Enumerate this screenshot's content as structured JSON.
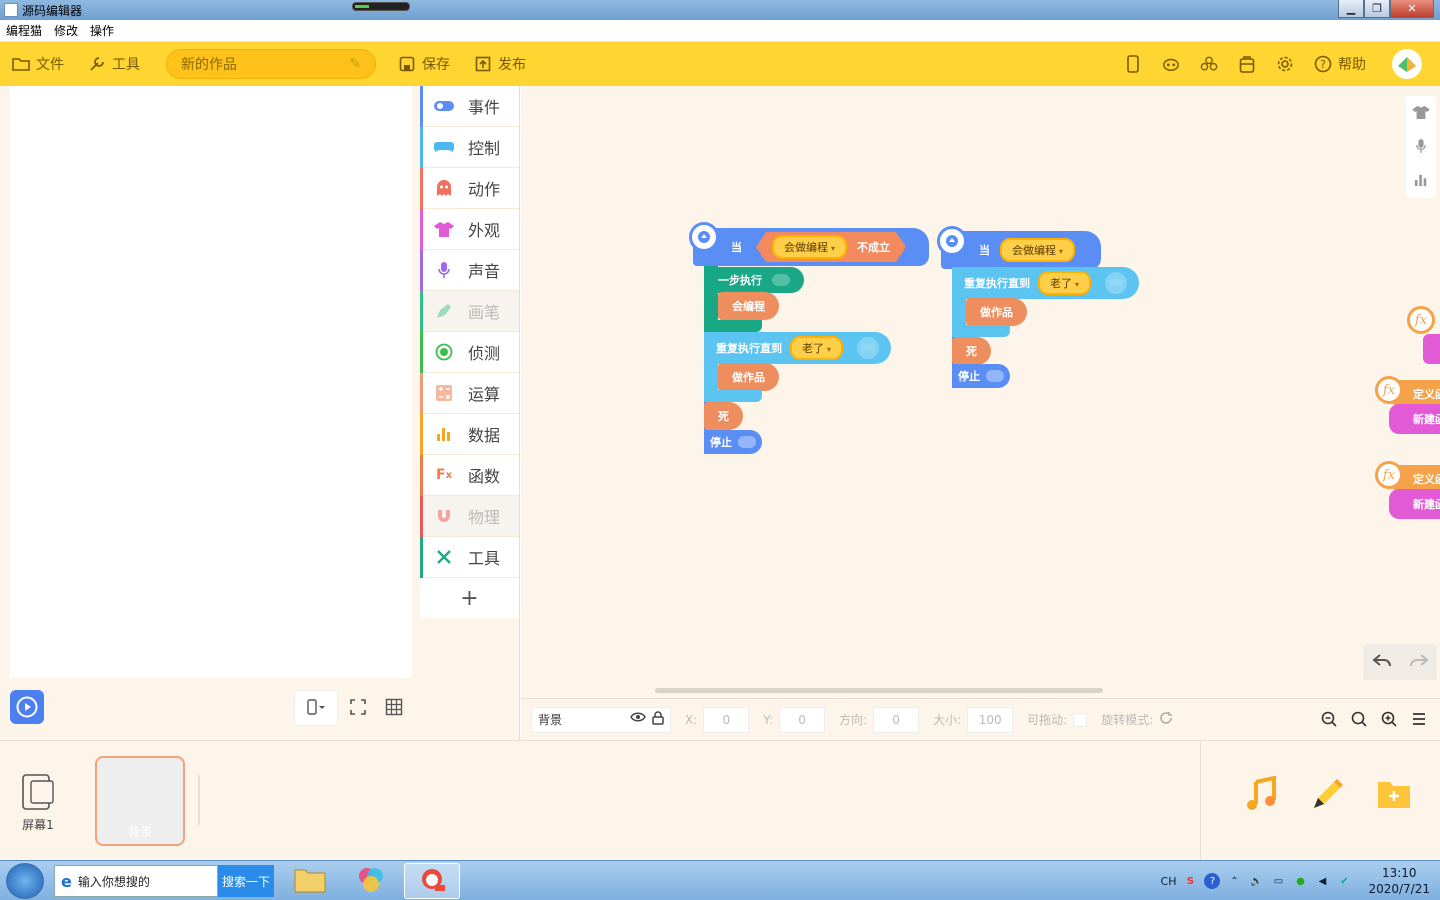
{
  "window": {
    "title": "源码编辑器"
  },
  "menu": {
    "items": [
      "编程猫",
      "修改",
      "操作"
    ]
  },
  "toolbar": {
    "file_label": "文件",
    "tools_label": "工具",
    "project_name": "新的作品",
    "save_label": "保存",
    "publish_label": "发布",
    "help_label": "帮助"
  },
  "categories": [
    {
      "label": "事件",
      "color": "#5b8ef5",
      "icon": "toggle-icon"
    },
    {
      "label": "控制",
      "color": "#4cb8f0",
      "icon": "gamepad-icon"
    },
    {
      "label": "动作",
      "color": "#f27060",
      "icon": "ghost-icon"
    },
    {
      "label": "外观",
      "color": "#e25ad6",
      "icon": "tshirt-icon"
    },
    {
      "label": "声音",
      "color": "#9f6ae8",
      "icon": "microphone-icon"
    },
    {
      "label": "画笔",
      "color": "#2fc08a",
      "icon": "pen-icon"
    },
    {
      "label": "侦测",
      "color": "#3cbf4a",
      "icon": "target-icon"
    },
    {
      "label": "运算",
      "color": "#f09a78",
      "icon": "calculator-icon"
    },
    {
      "label": "数据",
      "color": "#f5a623",
      "icon": "bar-chart-icon"
    },
    {
      "label": "函数",
      "color": "#f27a4a",
      "icon": "function-icon"
    },
    {
      "label": "物理",
      "color": "#e85a5a",
      "icon": "magnet-icon"
    },
    {
      "label": "工具",
      "color": "#1fa88a",
      "icon": "wrench-icon"
    }
  ],
  "palette": {
    "add_label": "+"
  },
  "script1": {
    "hat_label": "当",
    "condition_var": "会做编程",
    "condition_op": "不成立",
    "step_label": "一步执行",
    "step_child": "会编程",
    "repeat_label": "重复执行直到",
    "repeat_var": "老了",
    "repeat_child": "做作品",
    "after": "死",
    "stop": "停止"
  },
  "script2": {
    "hat_label": "当",
    "hat_var": "会做编程",
    "repeat_label": "重复执行直到",
    "repeat_var": "老了",
    "repeat_child": "做作品",
    "after": "死",
    "stop": "停止"
  },
  "fx_blocks": {
    "icon": "fx",
    "define": "定义函",
    "new": "新建函"
  },
  "properties": {
    "sprite_name": "背景",
    "x_label": "X:",
    "x_value": "0",
    "y_label": "Y:",
    "y_value": "0",
    "direction_label": "方向:",
    "direction_value": "0",
    "size_label": "大小:",
    "size_value": "100",
    "draggable_label": "可拖动:",
    "rotation_label": "旋转模式:"
  },
  "bottom": {
    "screen_label": "屏幕1",
    "sprite_card_label": "背景"
  },
  "taskbar": {
    "search_placeholder": "输入你想搜的",
    "search_button": "搜索一下",
    "lang": "CH",
    "time": "13:10",
    "date": "2020/7/21"
  },
  "colors": {
    "toolbar": "#ffd532",
    "event_blue": "#5b8ef5",
    "control_cyan": "#5bc4f0",
    "action_orange": "#ee8d5e",
    "step_green": "#18a886"
  }
}
